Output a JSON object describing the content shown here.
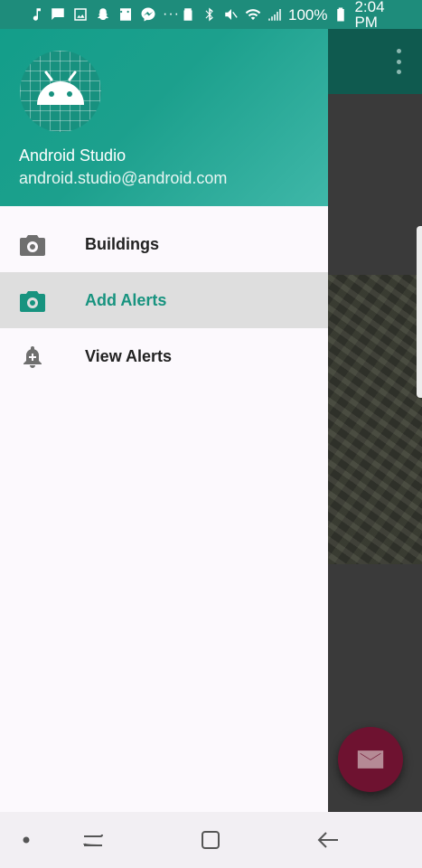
{
  "status_bar": {
    "battery": "100%",
    "time": "2:04 PM",
    "left_icons": [
      "music-note-icon",
      "message-icon",
      "gallery-icon",
      "snapchat-icon",
      "inbox-icon",
      "messenger-icon",
      "more-dots-icon"
    ],
    "right_icons": [
      "alarm-icon",
      "bluetooth-icon",
      "mute-icon",
      "wifi-icon",
      "signal-icon",
      "battery-icon"
    ],
    "background": "#1e8c7b"
  },
  "drawer": {
    "header": {
      "name": "Android Studio",
      "email": "android.studio@android.com",
      "gradient": [
        "#139e8a",
        "#3fb7a8"
      ]
    },
    "items": [
      {
        "label": "Buildings",
        "icon": "camera-icon",
        "active": false
      },
      {
        "label": "Add Alerts",
        "icon": "camera-icon",
        "active": true
      },
      {
        "label": "View Alerts",
        "icon": "add-alert-icon",
        "active": false
      }
    ],
    "accent": "#17937f"
  },
  "background_app": {
    "toolbar_icon": "overflow-menu-icon",
    "fab_icon": "mail-icon",
    "fab_color": "#6e1230"
  },
  "nav_bar": {
    "buttons": [
      "dot-icon",
      "recents-icon",
      "home-icon",
      "back-icon"
    ]
  }
}
